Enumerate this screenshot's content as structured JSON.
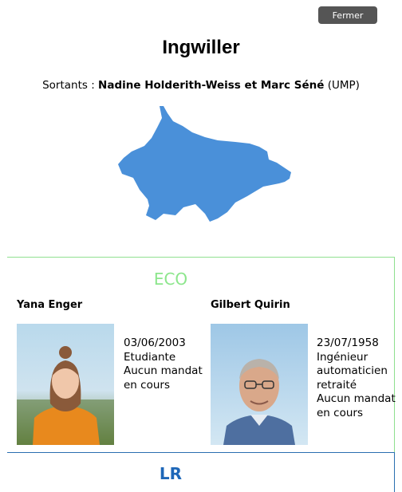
{
  "header": {
    "close_label": "Fermer"
  },
  "commune": {
    "title": "Ingwiller",
    "sortants_prefix": "Sortants :",
    "sortants_names": "Nadine Holderith-Weiss et Marc Séné",
    "sortants_party": "(UMP)",
    "map_color": "#4a90d9"
  },
  "parties": [
    {
      "name": "ECO",
      "color": "#8ce68c",
      "candidates": [
        {
          "name": "Yana Enger",
          "birth": "03/06/2003",
          "lines": [
            "Etudiante",
            "Aucun mandat",
            "en cours"
          ]
        },
        {
          "name": "Gilbert Quirin",
          "birth": "23/07/1958",
          "lines": [
            "Ingénieur",
            "automaticien",
            "retraité",
            "Aucun mandat",
            "en cours"
          ]
        }
      ]
    },
    {
      "name": "LR",
      "color": "#1e67b8"
    }
  ]
}
